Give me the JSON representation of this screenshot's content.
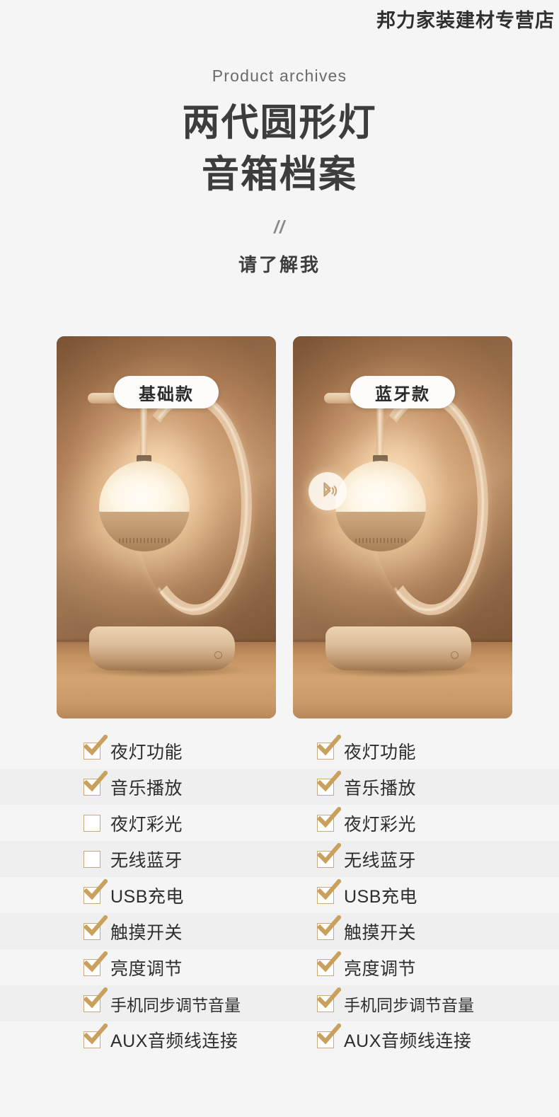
{
  "shop": {
    "name": "邦力家装建材专营店"
  },
  "title": {
    "eyebrow": "Product archives",
    "line1": "两代圆形灯",
    "line2": "音箱档案",
    "divider": "//",
    "tagline": "请了解我"
  },
  "products": [
    {
      "badge": "基础款",
      "has_bluetooth_icon": false,
      "icon": "lamp-speaker-photo"
    },
    {
      "badge": "蓝牙款",
      "has_bluetooth_icon": true,
      "icon": "bluetooth-icon"
    }
  ],
  "features": [
    {
      "label": "夜灯功能",
      "basic": true,
      "bluetooth": true,
      "compact": false
    },
    {
      "label": "音乐播放",
      "basic": true,
      "bluetooth": true,
      "compact": false
    },
    {
      "label": "夜灯彩光",
      "basic": false,
      "bluetooth": true,
      "compact": false
    },
    {
      "label": "无线蓝牙",
      "basic": false,
      "bluetooth": true,
      "compact": false
    },
    {
      "label": "USB充电",
      "basic": true,
      "bluetooth": true,
      "compact": false
    },
    {
      "label": "触摸开关",
      "basic": true,
      "bluetooth": true,
      "compact": false
    },
    {
      "label": "亮度调节",
      "basic": true,
      "bluetooth": true,
      "compact": false
    },
    {
      "label": "手机同步调节音量",
      "basic": true,
      "bluetooth": true,
      "compact": true
    },
    {
      "label": "AUX音频线连接",
      "basic": true,
      "bluetooth": true,
      "compact": false
    }
  ],
  "colors": {
    "page_bg": "#f5f5f5",
    "stripe_bg": "#efefef",
    "heading": "#3d3d3d",
    "checkbox_border": "#c8a97e",
    "check_gold": "#c9a05c",
    "photo_warm": "#c49a73"
  }
}
